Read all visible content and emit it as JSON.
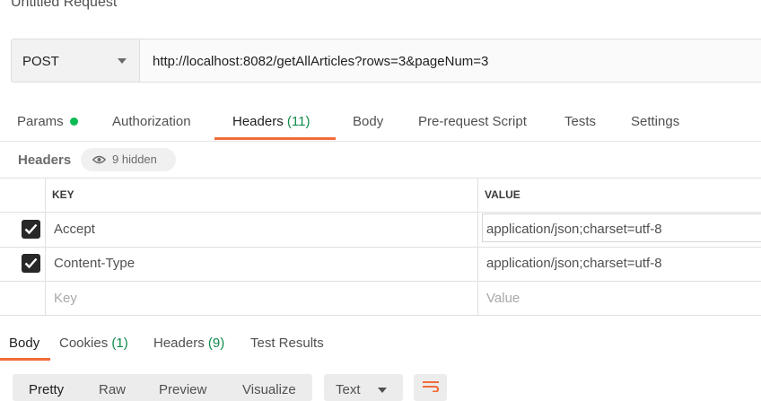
{
  "request": {
    "title": "Untitled Request",
    "method": "POST",
    "url": "http://localhost:8082/getAllArticles?rows=3&pageNum=3"
  },
  "request_tabs": {
    "params": "Params",
    "authorization": "Authorization",
    "headers": "Headers",
    "headers_count": "(11)",
    "body": "Body",
    "prerequest": "Pre-request Script",
    "tests": "Tests",
    "settings": "Settings"
  },
  "headers_section": {
    "label": "Headers",
    "hidden_text": "9 hidden"
  },
  "headers_table": {
    "columns": {
      "key": "KEY",
      "value": "VALUE"
    },
    "rows": [
      {
        "key": "Accept",
        "value": "application/json;charset=utf-8",
        "checked": true
      },
      {
        "key": "Content-Type",
        "value": "application/json;charset=utf-8",
        "checked": true
      }
    ],
    "new_row": {
      "key_placeholder": "Key",
      "value_placeholder": "Value"
    }
  },
  "response_tabs": {
    "body": "Body",
    "cookies": "Cookies",
    "cookies_count": "(1)",
    "headers": "Headers",
    "headers_count": "(9)",
    "test_results": "Test Results"
  },
  "body_toolbar": {
    "formats": [
      "Pretty",
      "Raw",
      "Preview",
      "Visualize"
    ],
    "language": "Text"
  },
  "colors": {
    "accent": "#f26b3a",
    "count_green": "#0f8b4c",
    "dot_green": "#0cbb52"
  }
}
